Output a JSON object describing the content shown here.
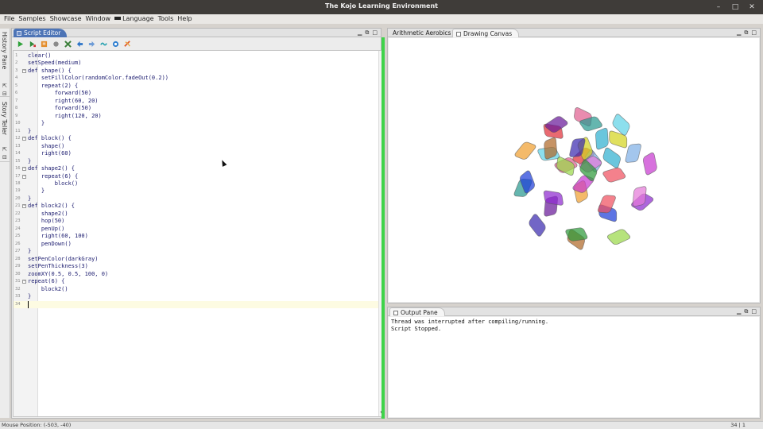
{
  "window": {
    "title": "The Kojo Learning Environment",
    "controls": [
      "–",
      "□",
      "✕"
    ]
  },
  "menubar": {
    "items": [
      "File",
      "Samples",
      "Showcase",
      "Window",
      "Language",
      "Tools",
      "Help"
    ]
  },
  "left_strip": {
    "tabs": [
      "History Pane",
      "Story Teller"
    ]
  },
  "script_editor": {
    "tab_label": "Script Editor",
    "toolbar_icons": [
      "run-icon",
      "run-worksheet-icon",
      "trace-icon",
      "compile-icon",
      "stop-icon",
      "undo-icon",
      "redo-icon",
      "format-icon",
      "clear-output-icon",
      "clear-editor-icon"
    ],
    "lines": [
      {
        "n": "1",
        "text": "clear()",
        "fold": false
      },
      {
        "n": "2",
        "text": "setSpeed(medium)",
        "fold": false
      },
      {
        "n": "3",
        "text": "def shape() {",
        "fold": true
      },
      {
        "n": "4",
        "text": "    setFillColor(randomColor.fadeOut(0.2))",
        "fold": false
      },
      {
        "n": "5",
        "text": "    repeat(2) {",
        "fold": false
      },
      {
        "n": "6",
        "text": "        forward(50)",
        "fold": false
      },
      {
        "n": "7",
        "text": "        right(60, 20)",
        "fold": false
      },
      {
        "n": "8",
        "text": "        forward(50)",
        "fold": false
      },
      {
        "n": "9",
        "text": "        right(120, 20)",
        "fold": false
      },
      {
        "n": "10",
        "text": "    }",
        "fold": false
      },
      {
        "n": "11",
        "text": "}",
        "fold": false
      },
      {
        "n": "12",
        "text": "def block() {",
        "fold": true
      },
      {
        "n": "13",
        "text": "    shape()",
        "fold": false
      },
      {
        "n": "14",
        "text": "    right(60)",
        "fold": false
      },
      {
        "n": "15",
        "text": "}",
        "fold": false
      },
      {
        "n": "16",
        "text": "def shape2() {",
        "fold": true
      },
      {
        "n": "17",
        "text": "    repeat(6) {",
        "fold": true
      },
      {
        "n": "18",
        "text": "        block()",
        "fold": false
      },
      {
        "n": "19",
        "text": "    }",
        "fold": false
      },
      {
        "n": "20",
        "text": "}",
        "fold": false
      },
      {
        "n": "21",
        "text": "def block2() {",
        "fold": true
      },
      {
        "n": "22",
        "text": "    shape2()",
        "fold": false
      },
      {
        "n": "23",
        "text": "    hop(50)",
        "fold": false
      },
      {
        "n": "24",
        "text": "    penUp()",
        "fold": false
      },
      {
        "n": "25",
        "text": "    right(60, 100)",
        "fold": false
      },
      {
        "n": "26",
        "text": "    penDown()",
        "fold": false
      },
      {
        "n": "27",
        "text": "}",
        "fold": false
      },
      {
        "n": "28",
        "text": "setPenColor(darkGray)",
        "fold": false
      },
      {
        "n": "29",
        "text": "setPenThickness(3)",
        "fold": false
      },
      {
        "n": "30",
        "text": "zoomXY(0.5, 0.5, 100, 0)",
        "fold": false
      },
      {
        "n": "31",
        "text": "repeat(6) {",
        "fold": true
      },
      {
        "n": "32",
        "text": "    block2()",
        "fold": false
      },
      {
        "n": "33",
        "text": "}",
        "fold": false
      },
      {
        "n": "34",
        "text": "",
        "fold": false
      }
    ]
  },
  "right_top": {
    "tabs": [
      "Arithmetic Aerobics",
      "Drawing Canvas"
    ],
    "active_tab": "Drawing Canvas"
  },
  "output_pane": {
    "tab_label": "Output Pane",
    "lines": [
      "Thread was interrupted after compiling/running.",
      "Script Stopped."
    ]
  },
  "statusbar": {
    "mouse_position": "Mouse Position: (-503, -40)",
    "caret_position": "34 | 1"
  },
  "colors": {
    "title_bar": "#3f3c39",
    "active_tab_blue": "#4d74b6",
    "run_indicator": "#3fd34a",
    "current_line": "#fdfbe2"
  }
}
